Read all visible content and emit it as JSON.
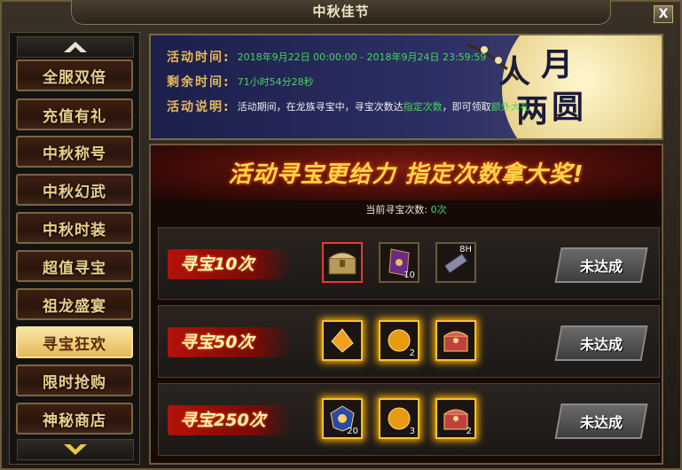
{
  "window": {
    "title": "中秋佳节",
    "close_label": "X"
  },
  "sidebar": {
    "items": [
      {
        "label": "全服双倍"
      },
      {
        "label": "充值有礼"
      },
      {
        "label": "中秋称号"
      },
      {
        "label": "中秋幻武"
      },
      {
        "label": "中秋时装"
      },
      {
        "label": "超值寻宝"
      },
      {
        "label": "祖龙盛宴"
      },
      {
        "label": "寻宝狂欢"
      },
      {
        "label": "限时抢购"
      },
      {
        "label": "神秘商店"
      }
    ],
    "selected_index": 7
  },
  "info": {
    "time_label": "活动时间:",
    "time_value": "2018年9月22日 00:00:00 - 2018年9月24日 23:59:59",
    "remain_label": "剩余时间:",
    "remain_value": "71小时54分28秒",
    "desc_label": "活动说明:",
    "desc_part1": "活动期间，在龙族寻宝中，寻宝次数达",
    "desc_hl1": "指定次数",
    "desc_part2": "，即可领取",
    "desc_hl2": "额外大礼",
    "desc_part3": "。",
    "calligraphy": [
      "人",
      "月",
      "两",
      "圆"
    ]
  },
  "banner": {
    "text": "活动寻宝更给力 指定次数拿大奖!"
  },
  "count": {
    "label": "当前寻宝次数:",
    "value": "0次"
  },
  "tiers": [
    {
      "label": "寻宝10次",
      "status": "未达成",
      "items": [
        {
          "icon": "treasure-chest-icon",
          "count": ""
        },
        {
          "icon": "purple-ticket-icon",
          "count": "10"
        },
        {
          "icon": "scroll-icon",
          "count": "",
          "badge": "8H"
        }
      ]
    },
    {
      "label": "寻宝50次",
      "status": "未达成",
      "items": [
        {
          "icon": "gold-shard-icon",
          "count": ""
        },
        {
          "icon": "gold-orb-icon",
          "count": "2"
        },
        {
          "icon": "jeweled-chest-icon",
          "count": ""
        }
      ]
    },
    {
      "label": "寻宝250次",
      "status": "未达成",
      "items": [
        {
          "icon": "blue-emblem-icon",
          "count": "20"
        },
        {
          "icon": "gold-orb-icon",
          "count": "3"
        },
        {
          "icon": "jeweled-chest-icon",
          "count": "2"
        }
      ]
    }
  ],
  "colors": {
    "accent_green": "#46d85a",
    "label_gold": "#e7b85b",
    "banner_yellow": "#ffd64a"
  }
}
